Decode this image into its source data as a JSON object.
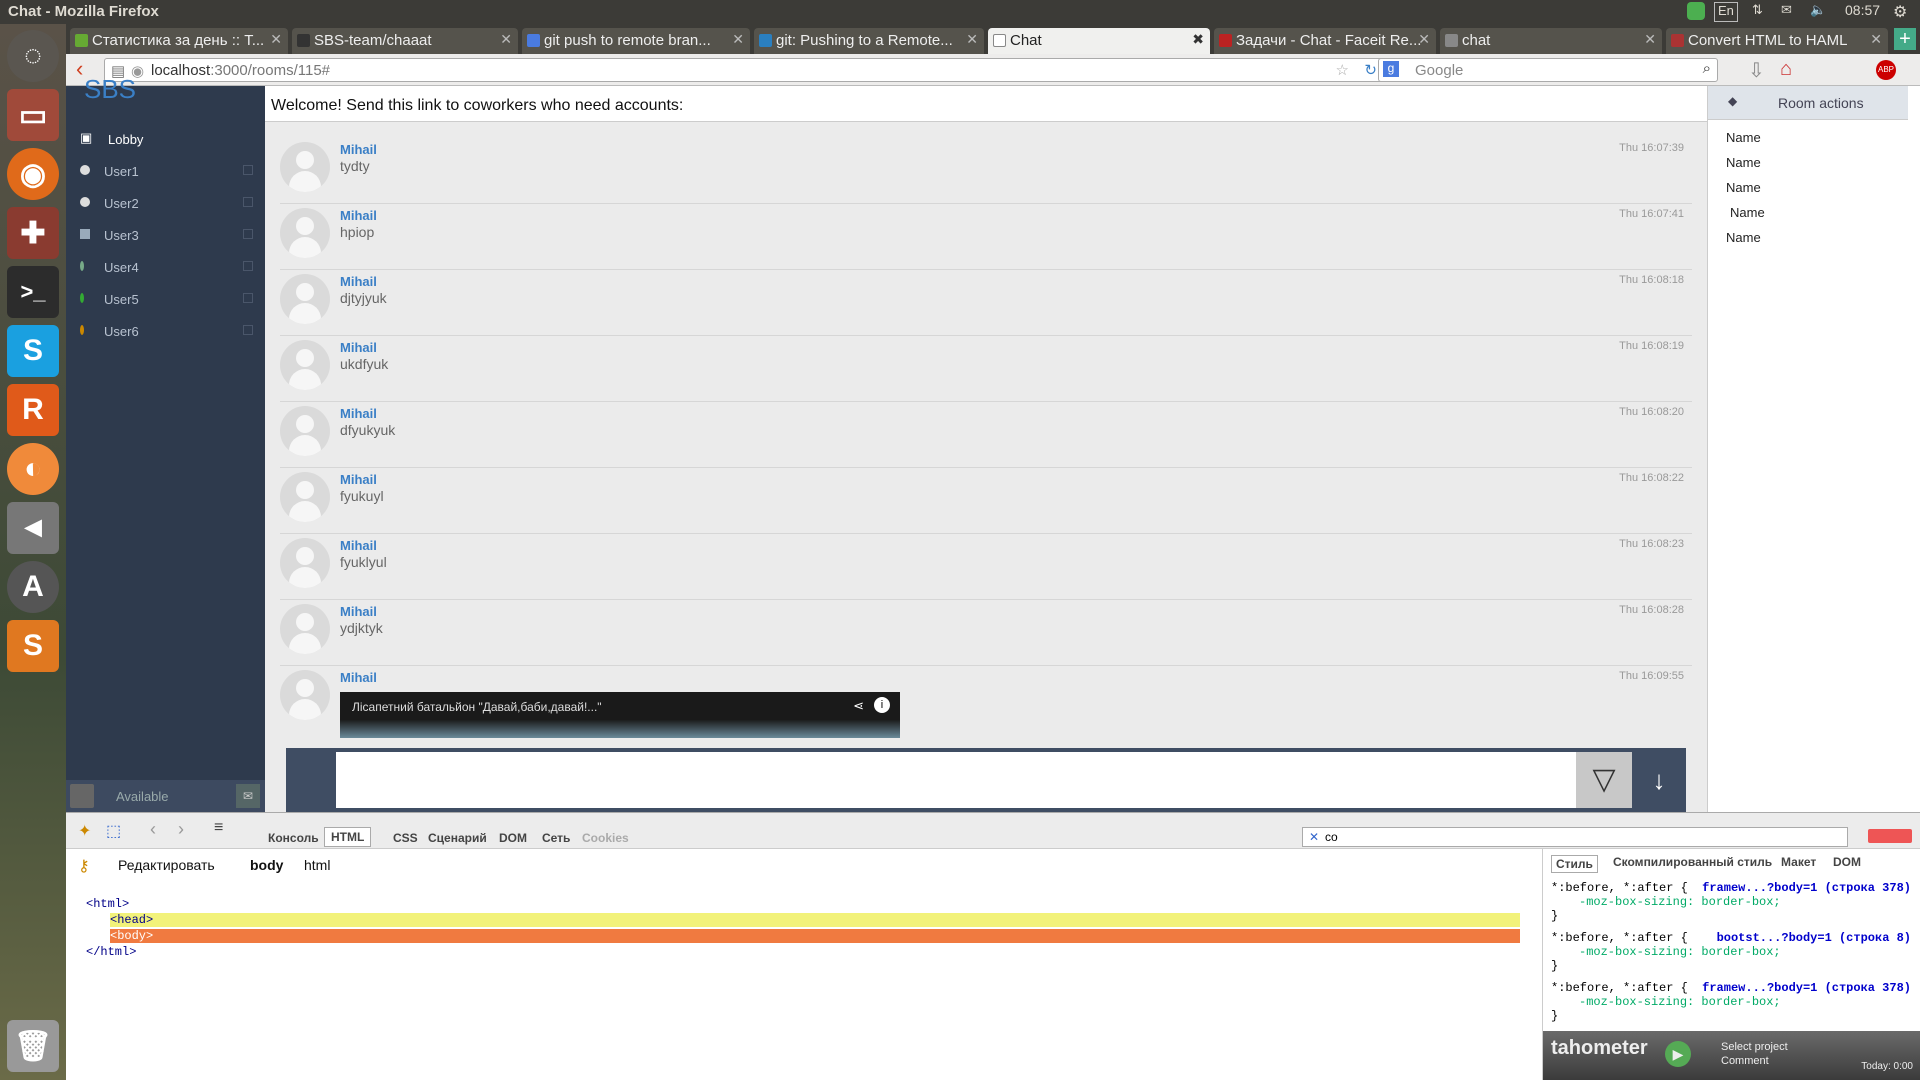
{
  "window": {
    "title": "Chat - Mozilla Firefox",
    "clock": "08:57",
    "lang": "En"
  },
  "tabs": [
    {
      "label": "Статистика за день :: T...",
      "color": "#6a3"
    },
    {
      "label": "SBS-team/chaaat",
      "color": "#333"
    },
    {
      "label": "git push to remote bran...",
      "color": "#4a7be0"
    },
    {
      "label": "git: Pushing to a Remote...",
      "color": "#2a7fc0"
    },
    {
      "label": "Chat",
      "color": "#fff"
    },
    {
      "label": "Задачи - Chat - Faceit Re...",
      "color": "#b22"
    },
    {
      "label": "chat",
      "color": "#888"
    },
    {
      "label": "Convert HTML to HAML",
      "color": "#a33"
    }
  ],
  "url": {
    "host": "localhost",
    "path": ":3000/rooms/115#",
    "search_placeholder": "Google"
  },
  "sidebar": {
    "logo": "SBS",
    "lobby": "Lobby",
    "users": [
      {
        "label": "User1",
        "color": "#ddd"
      },
      {
        "label": "User2",
        "color": "#ddd"
      },
      {
        "label": "User3",
        "color": "#9ab"
      },
      {
        "label": "User4",
        "color": "#7a8"
      },
      {
        "label": "User5",
        "color": "#3a3"
      },
      {
        "label": "User6",
        "color": "#c80"
      }
    ],
    "status": "Available"
  },
  "welcome": "Welcome! Send this link to coworkers who need accounts:",
  "messages": [
    {
      "name": "Mihail",
      "text": "tydty",
      "time": "Thu 16:07:39"
    },
    {
      "name": "Mihail",
      "text": "hpiop",
      "time": "Thu 16:07:41"
    },
    {
      "name": "Mihail",
      "text": "djtyjyuk",
      "time": "Thu 16:08:18"
    },
    {
      "name": "Mihail",
      "text": "ukdfyuk",
      "time": "Thu 16:08:19"
    },
    {
      "name": "Mihail",
      "text": "dfyukyuk",
      "time": "Thu 16:08:20"
    },
    {
      "name": "Mihail",
      "text": "fyukuyl",
      "time": "Thu 16:08:22"
    },
    {
      "name": "Mihail",
      "text": "fyuklyul",
      "time": "Thu 16:08:23"
    },
    {
      "name": "Mihail",
      "text": "ydjktyk",
      "time": "Thu 16:08:28"
    },
    {
      "name": "Mihail",
      "text": "",
      "time": "Thu 16:09:55"
    }
  ],
  "video": {
    "title": "Лісапетний батальйон \"Давай,баби,давай!...\""
  },
  "room": {
    "actions": "Room actions",
    "members": [
      "Name",
      "Name",
      "Name",
      "Name",
      "Name"
    ]
  },
  "devtools": {
    "tabs": [
      "Консоль",
      "HTML",
      "CSS",
      "Сценарий",
      "DOM",
      "Сеть",
      "Cookies"
    ],
    "search": "co",
    "edit": "Редактировать",
    "crumb1": "body",
    "crumb2": "html",
    "right_tabs": [
      "Стиль",
      "Скомпилированный стиль",
      "Макет",
      "DOM"
    ],
    "tree": [
      "<html>",
      "<head>",
      "<body>",
      "</html>"
    ],
    "rules": [
      {
        "sel": "*:before, *:after {",
        "src": "framew...?body=1 (строка 378)",
        "prop": "-moz-box-sizing: border-box;"
      },
      {
        "sel": "*:before, *:after {",
        "src": "bootst...?body=1 (строка 8)",
        "prop": "-moz-box-sizing: border-box;"
      },
      {
        "sel": "*:before, *:after {",
        "src": "framew...?body=1 (строка 378)",
        "prop": "-moz-box-sizing: border-box;"
      }
    ]
  },
  "tahometer": {
    "brand": "tahometer",
    "project": "Select project",
    "comment": "Comment",
    "today": "Today: 0:00"
  }
}
